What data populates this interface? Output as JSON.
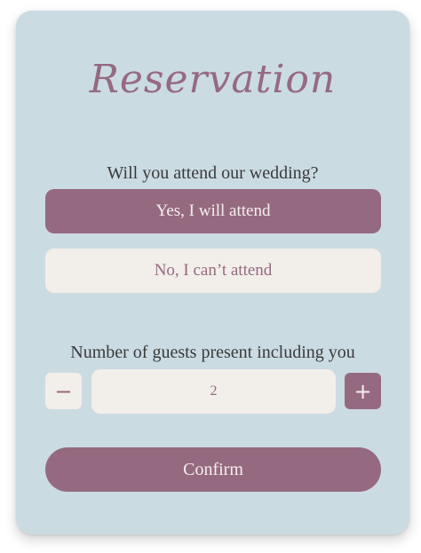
{
  "title": "Reservation",
  "question": "Will you attend our wedding?",
  "options": {
    "yes": "Yes, I will attend",
    "no": "No, I can’t attend"
  },
  "guests": {
    "label": "Number of guests present including you",
    "value": "2",
    "minus": "−",
    "plus": "+"
  },
  "confirm_label": "Confirm",
  "colors": {
    "card_bg": "#cbdbe2",
    "accent": "#956a80",
    "light_button": "#f2eee9"
  }
}
